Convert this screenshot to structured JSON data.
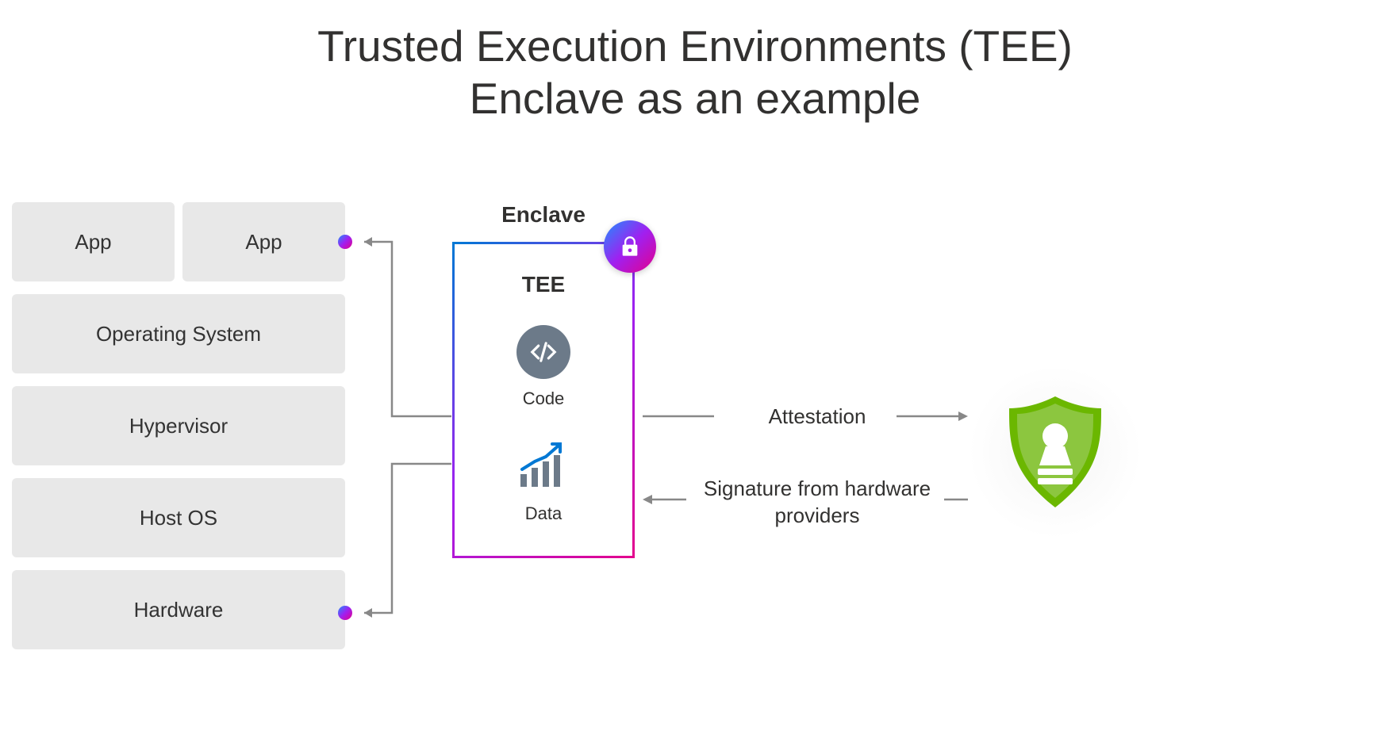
{
  "title": {
    "line1": "Trusted Execution Environments (TEE)",
    "line2": "Enclave as an example"
  },
  "stack": {
    "app1": "App",
    "app2": "App",
    "os": "Operating System",
    "hypervisor": "Hypervisor",
    "host_os": "Host OS",
    "hardware": "Hardware"
  },
  "enclave": {
    "label": "Enclave",
    "inner_title": "TEE",
    "code_label": "Code",
    "data_label": "Data"
  },
  "arrows": {
    "attestation": "Attestation",
    "signature": "Signature from hardware providers"
  },
  "icons": {
    "lock": "lock-icon",
    "code": "code-icon",
    "data": "chart-icon",
    "shield": "shield-stamp-icon"
  },
  "colors": {
    "block_bg": "#e8e8e8",
    "gradient_start": "#0078d4",
    "gradient_mid": "#a020f0",
    "gradient_end": "#e3008c",
    "shield_green": "#6BB700",
    "arrow": "#888888"
  }
}
